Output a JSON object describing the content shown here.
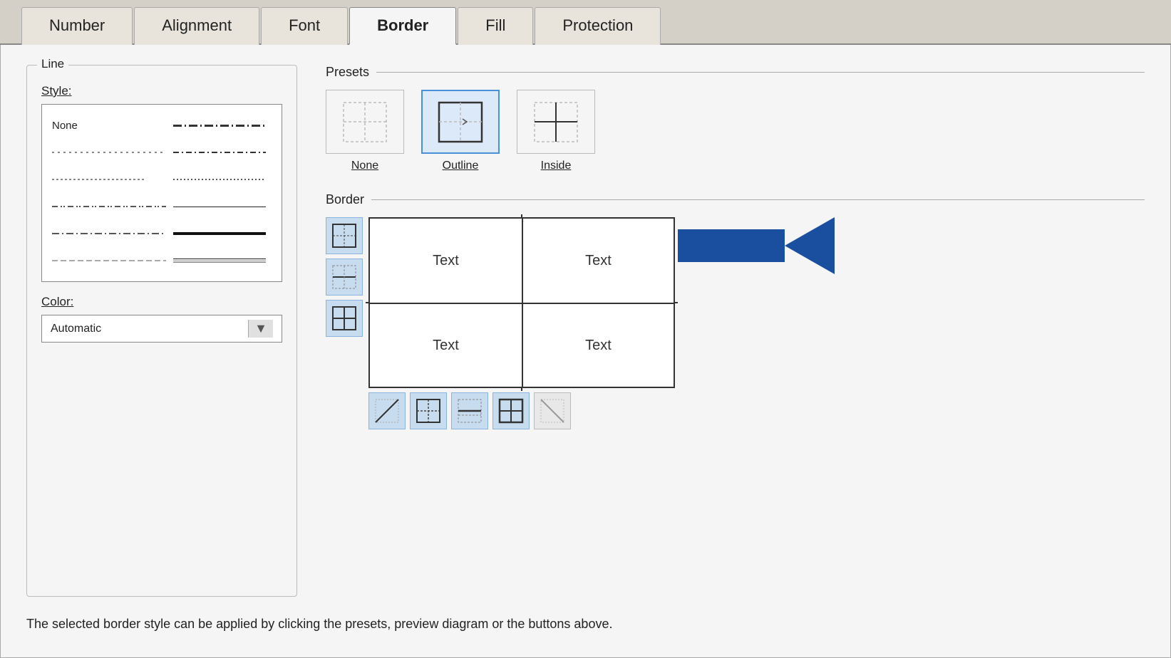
{
  "tabs": [
    {
      "id": "number",
      "label": "Number",
      "active": false
    },
    {
      "id": "alignment",
      "label": "Alignment",
      "active": false
    },
    {
      "id": "font",
      "label": "Font",
      "active": false
    },
    {
      "id": "border",
      "label": "Border",
      "active": true
    },
    {
      "id": "fill",
      "label": "Fill",
      "active": false
    },
    {
      "id": "protection",
      "label": "Protection",
      "active": false
    }
  ],
  "left_panel": {
    "title": "Line",
    "style_label": "Style:",
    "color_label": "Color:",
    "color_value": "Automatic",
    "none_label": "None"
  },
  "right_panel": {
    "presets_label": "Presets",
    "border_label": "Border",
    "none_label": "None",
    "outline_label": "Outline",
    "inside_label": "Inside",
    "text1": "Text",
    "text2": "Text",
    "text3": "Text",
    "text4": "Text"
  },
  "hint": "The selected border style can be applied by clicking the presets, preview diagram or the buttons above."
}
